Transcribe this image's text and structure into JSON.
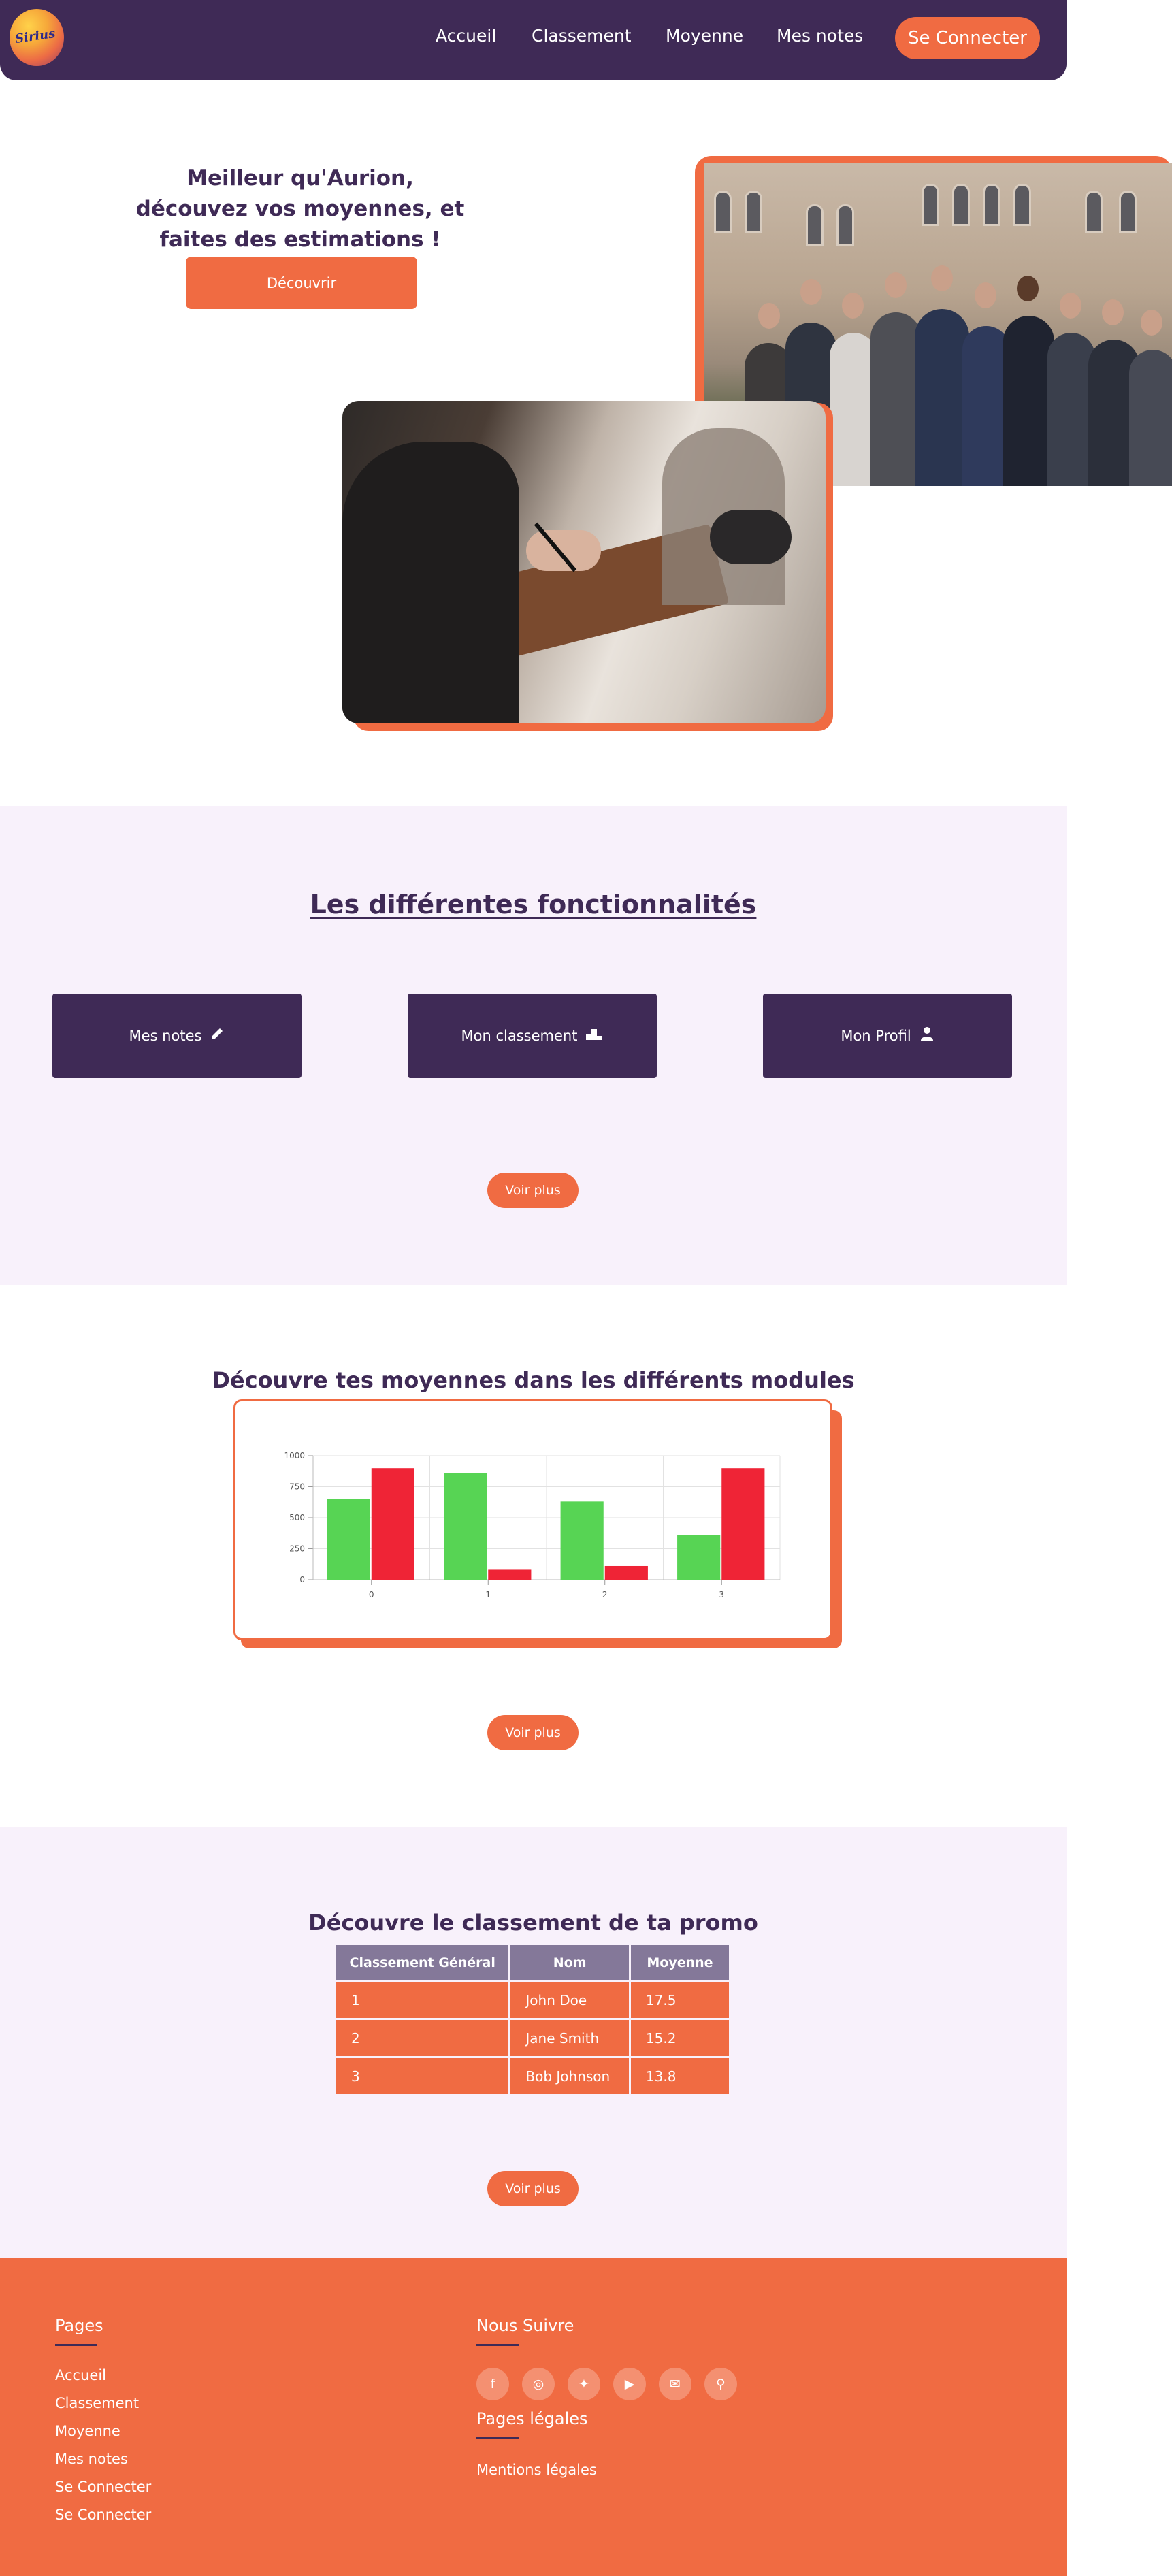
{
  "nav": {
    "logo_text": "Sirius",
    "links": [
      "Accueil",
      "Classement",
      "Moyenne",
      "Mes notes"
    ],
    "login": "Se Connecter"
  },
  "hero": {
    "title": "Meilleur qu'Aurion, découvez vos moyennes, et faites des estimations !",
    "button": "Découvrir"
  },
  "features": {
    "title": "Les différentes fonctionnalités",
    "cards": [
      {
        "label": "Mes notes",
        "icon": "pencil-icon"
      },
      {
        "label": "Mon classement",
        "icon": "podium-icon"
      },
      {
        "label": "Mon Profil",
        "icon": "user-icon"
      }
    ],
    "more": "Voir plus"
  },
  "chart_section": {
    "title": "Découvre tes moyennes dans les différents modules",
    "more": "Voir plus"
  },
  "chart_data": {
    "type": "bar",
    "categories": [
      "0",
      "1",
      "2",
      "3"
    ],
    "series": [
      {
        "color": "#57d454",
        "values": [
          650,
          860,
          630,
          360
        ]
      },
      {
        "color": "#ef2436",
        "values": [
          900,
          80,
          110,
          900
        ]
      }
    ],
    "yticks": [
      "0",
      "250",
      "500",
      "750",
      "1000"
    ],
    "ylim": [
      0,
      1000
    ],
    "grid": true
  },
  "ranking": {
    "title": "Découvre le classement de ta promo",
    "headers": [
      "Classement Général",
      "Nom",
      "Moyenne"
    ],
    "rows": [
      [
        "1",
        "John Doe",
        "17.5"
      ],
      [
        "2",
        "Jane Smith",
        "15.2"
      ],
      [
        "3",
        "Bob Johnson",
        "13.8"
      ]
    ],
    "more": "Voir plus"
  },
  "footer": {
    "pages_heading": "Pages",
    "pages": [
      "Accueil",
      "Classement",
      "Moyenne",
      "Mes notes",
      "Se Connecter",
      "Se Connecter"
    ],
    "follow_heading": "Nous Suivre",
    "social": [
      {
        "icon": "facebook-icon",
        "glyph": "f"
      },
      {
        "icon": "instagram-icon",
        "glyph": "◎"
      },
      {
        "icon": "twitter-icon",
        "glyph": "✦"
      },
      {
        "icon": "youtube-icon",
        "glyph": "▶"
      },
      {
        "icon": "mail-icon",
        "glyph": "✉"
      },
      {
        "icon": "location-icon",
        "glyph": "⚲"
      }
    ],
    "legal_heading": "Pages légales",
    "legal": [
      "Mentions légales"
    ]
  }
}
